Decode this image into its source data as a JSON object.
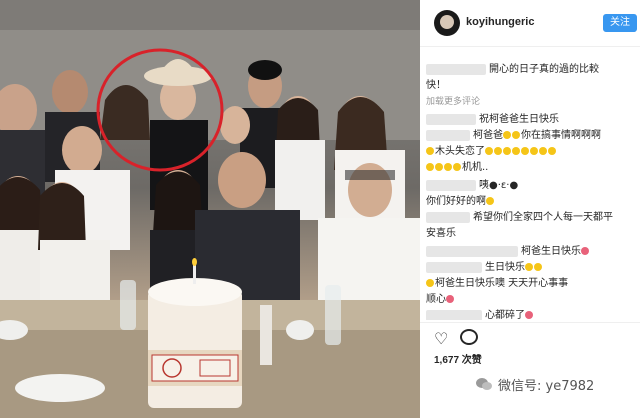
{
  "post": {
    "username": "koyihungeric",
    "follow_label": "关注",
    "likes": "1,677 次赞"
  },
  "comments": {
    "caption_a": "開心的日子真的過的比較",
    "caption_b": "快！",
    "load_more": "加载更多评论",
    "c1": "祝柯爸爸生日快乐",
    "c2": "柯爸爸",
    "c2b": "你在搞事情啊啊啊",
    "c3": "木头失恋了",
    "c4": "机机..",
    "c5": "咦●·ε·●",
    "c6": "你们好好的啊",
    "c7": "希望你们全家四个人每一天都平",
    "c8": "安喜乐",
    "c9": "柯爸生日快乐",
    "c10": "生日快乐",
    "c11": "柯爸爸",
    "c12": "柯爸生日快乐噢 天天开心事事",
    "c13": "顺心",
    "c14": "心都碎了"
  },
  "watermark": {
    "text": "微信号: ye7982"
  },
  "colors": {
    "follow_bg": "#3897f0",
    "circle": "#d8222a"
  }
}
